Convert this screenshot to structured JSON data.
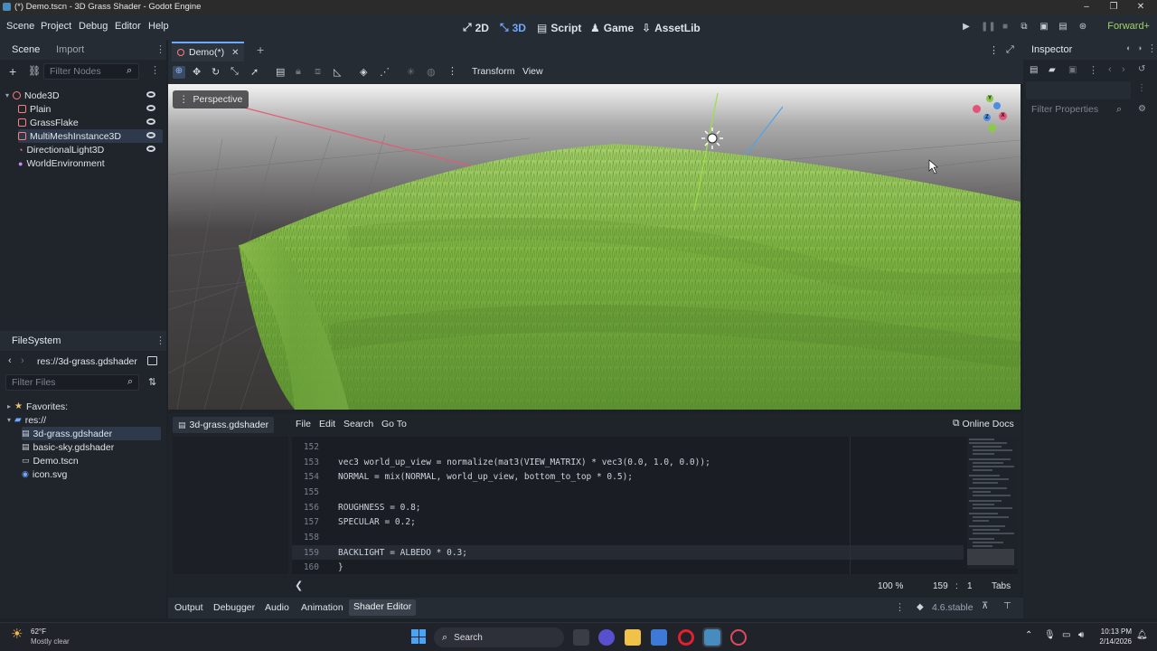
{
  "window": {
    "title": "(*) Demo.tscn - 3D Grass Shader - Godot Engine",
    "minimize_glyph": "–",
    "restore_glyph": "❐",
    "close_glyph": "✕"
  },
  "menu": {
    "items": [
      "Scene",
      "Project",
      "Debug",
      "Editor",
      "Help"
    ]
  },
  "modes": {
    "m2d": "2D",
    "m3d": "3D",
    "script": "Script",
    "game": "Game",
    "assetlib": "AssetLib"
  },
  "renderer": "Forward+",
  "scene_dock": {
    "tab_scene": "Scene",
    "tab_import": "Import",
    "filter_placeholder": "Filter Nodes",
    "nodes": [
      {
        "label": "Node3D",
        "color": "#fc7f7f"
      },
      {
        "label": "Plain",
        "color": "#fc7f7f"
      },
      {
        "label": "GrassFlake",
        "color": "#fc7f7f"
      },
      {
        "label": "MultiMeshInstance3D",
        "color": "#fc7f7f"
      },
      {
        "label": "DirectionalLight3D",
        "color": "#fc7f7f"
      },
      {
        "label": "WorldEnvironment",
        "color": "#fc7f7f"
      }
    ]
  },
  "filesystem": {
    "title": "FileSystem",
    "path": "res://3d-grass.gdshader",
    "filter_placeholder": "Filter Files",
    "favorites": "Favorites:",
    "root": "res://",
    "files": [
      "3d-grass.gdshader",
      "basic-sky.gdshader",
      "Demo.tscn",
      "icon.svg"
    ]
  },
  "editor_tab": {
    "label": "Demo(*)"
  },
  "viewport_toolbar": {
    "transform": "Transform",
    "view": "View",
    "perspective": "Perspective"
  },
  "gizmo": {
    "x": "X",
    "y": "Y",
    "z": "Z"
  },
  "shader_editor": {
    "file_tab": "3d-grass.gdshader",
    "menus": [
      "File",
      "Edit",
      "Search",
      "Go To"
    ],
    "online_docs": "Online Docs",
    "lines": [
      {
        "n": "152",
        "code": ""
      },
      {
        "n": "153",
        "code": "vec3 world_up_view = normalize(mat3(VIEW_MATRIX) * vec3(0.0, 1.0, 0.0));"
      },
      {
        "n": "154",
        "code": "NORMAL = mix(NORMAL, world_up_view, bottom_to_top * 0.5);"
      },
      {
        "n": "155",
        "code": ""
      },
      {
        "n": "156",
        "code": "ROUGHNESS = 0.8;"
      },
      {
        "n": "157",
        "code": "SPECULAR = 0.2;"
      },
      {
        "n": "158",
        "code": ""
      },
      {
        "n": "159",
        "code": "BACKLIGHT = ALBEDO * 0.3;"
      },
      {
        "n": "160",
        "code": "}"
      }
    ],
    "status": {
      "zoom": "100 %",
      "line": "159",
      "sep": ":",
      "col": "1",
      "indent": "Tabs"
    }
  },
  "bottom_panel": {
    "tabs": [
      "Output",
      "Debugger",
      "Audio",
      "Animation",
      "Shader Editor"
    ],
    "version": "4.6.stable"
  },
  "inspector": {
    "title": "Inspector",
    "filter_placeholder": "Filter Properties"
  },
  "taskbar": {
    "weather_temp": "62°F",
    "weather_desc": "Mostly clear",
    "search": "Search",
    "time": "10:13 PM",
    "date": "2/14/2026"
  }
}
